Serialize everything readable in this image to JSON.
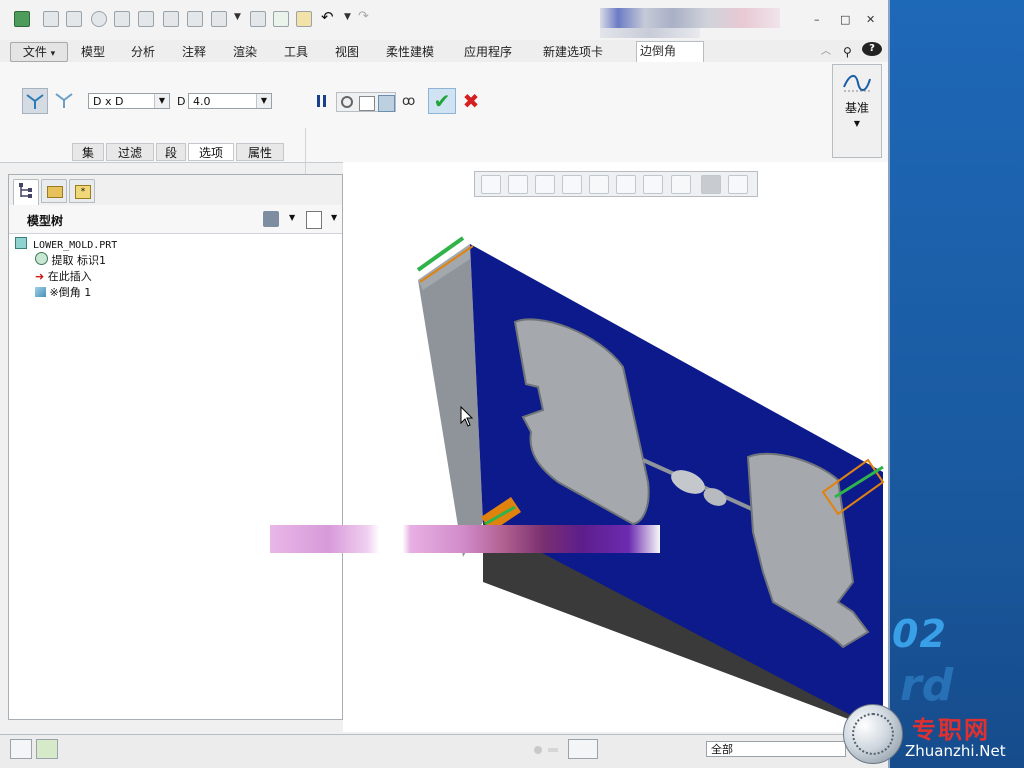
{
  "window_title_blurred": true,
  "window_controls": {
    "minimize": "–",
    "restore": "□",
    "close": "✕"
  },
  "menu_tabs": [
    {
      "label": "文件",
      "dropdown": "▾"
    },
    {
      "label": "模型"
    },
    {
      "label": "分析"
    },
    {
      "label": "注释"
    },
    {
      "label": "渲染"
    },
    {
      "label": "工具"
    },
    {
      "label": "视图"
    },
    {
      "label": "柔性建模"
    },
    {
      "label": "应用程序"
    },
    {
      "label": "新建选项卡"
    },
    {
      "label": "边倒角",
      "active": true
    }
  ],
  "ribbon": {
    "set_mode_combo": "D x D",
    "d_label": "D",
    "d_value": "4.0",
    "subtabs": [
      "集",
      "过滤",
      "段",
      "选项",
      "属性"
    ],
    "active_subtab": "选项",
    "datum_label": "基准"
  },
  "model_tree": {
    "title": "模型树",
    "items": [
      {
        "icon": "part-icon",
        "label": "LOWER_MOLD.PRT"
      },
      {
        "icon": "extract-feature-icon",
        "label": "提取 标识1"
      },
      {
        "icon": "insert-here-arrow-icon",
        "label": "在此插入"
      },
      {
        "icon": "round-feature-icon",
        "label": "※倒角 1"
      }
    ]
  },
  "status_bar": {
    "filter_value": "全部"
  },
  "brand": {
    "number": "02",
    "rd": "rd",
    "site_cn": "专职网",
    "site_en": "Zhuanzhi.Net"
  },
  "colors": {
    "mold_blue": "#0d1a8c",
    "edge_green": "#2fb34a",
    "highlight_orange": "#e0820e",
    "accept_green": "#1fa53a",
    "cancel_red": "#d42020"
  }
}
